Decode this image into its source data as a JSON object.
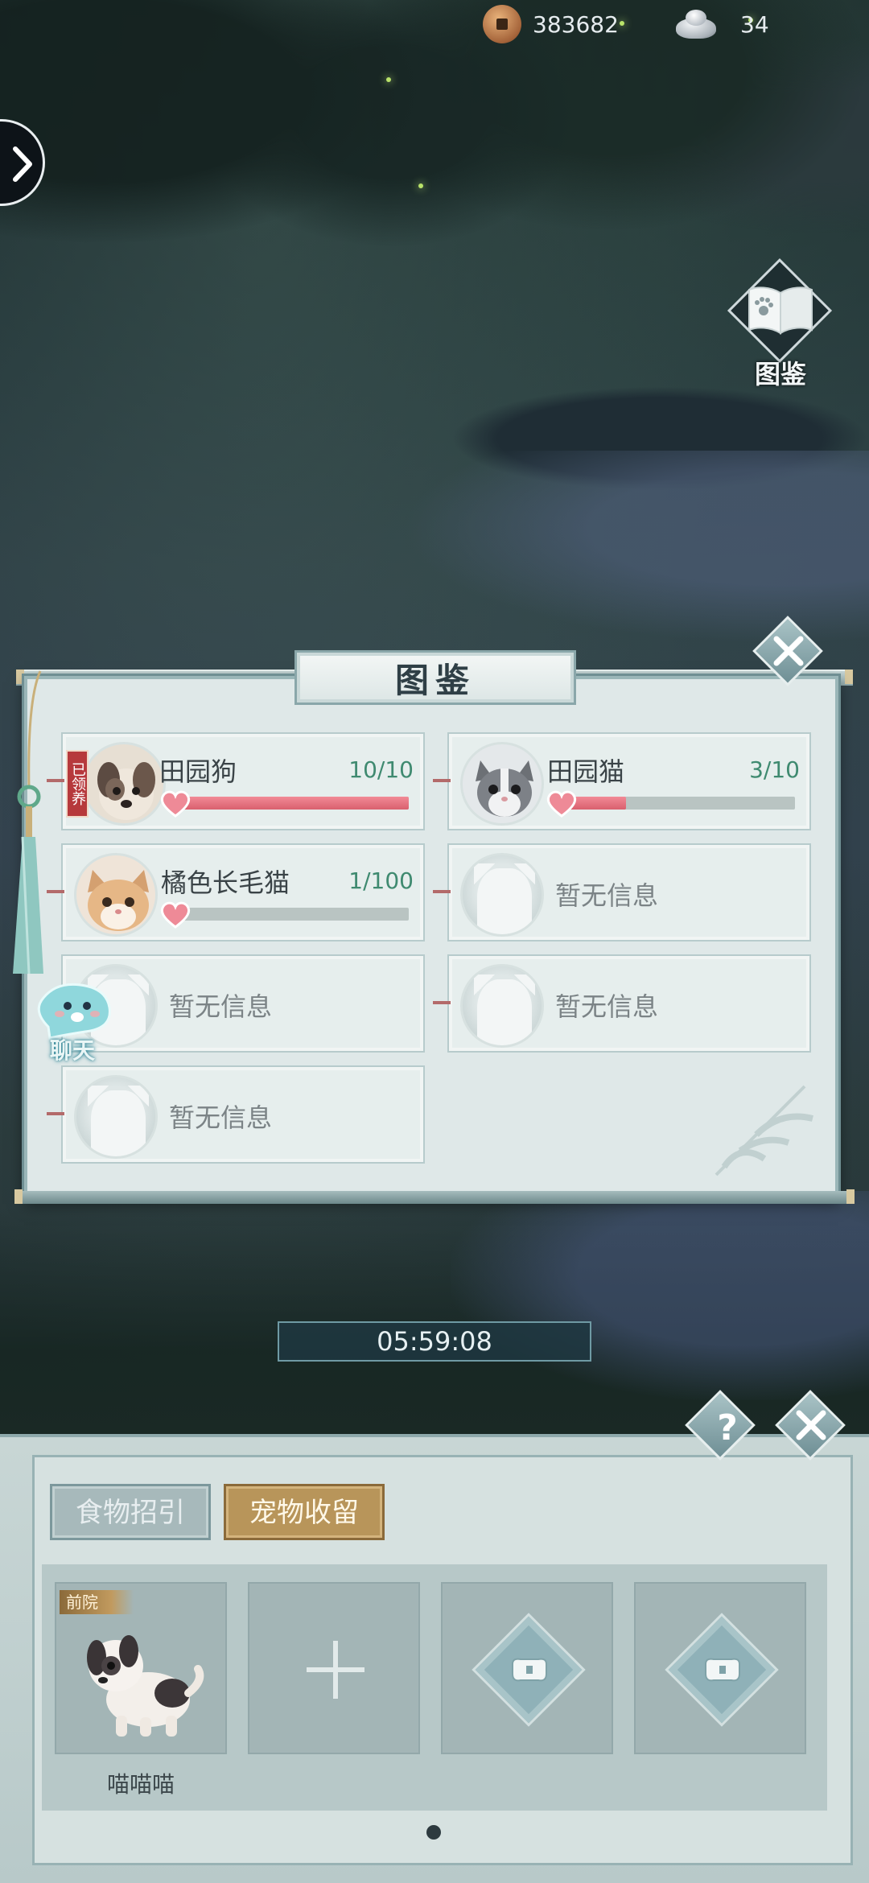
{
  "currency": {
    "coins": "383682",
    "silver": "34"
  },
  "book_button": {
    "label": "图鉴"
  },
  "encyclopedia": {
    "title": "图鉴",
    "pets": [
      {
        "name": "田园狗",
        "count": "10/10",
        "progress": 1.0,
        "adopted": true,
        "adopted_label": "已领养",
        "avatar": "dog"
      },
      {
        "name": "田园猫",
        "count": "3/10",
        "progress": 0.3,
        "adopted": false,
        "avatar": "gray-cat"
      },
      {
        "name": "橘色长毛猫",
        "count": "1/100",
        "progress": 0.01,
        "adopted": false,
        "avatar": "orange-cat"
      },
      {
        "name": "暂无信息",
        "empty": true
      },
      {
        "name": "暂无信息",
        "empty": true
      },
      {
        "name": "暂无信息",
        "empty": true
      },
      {
        "name": "暂无信息",
        "empty": true
      }
    ]
  },
  "chat": {
    "label": "聊天"
  },
  "timer": "05:59:08",
  "bottom": {
    "tabs": [
      {
        "label": "食物招引",
        "active": false
      },
      {
        "label": "宠物收留",
        "active": true
      }
    ],
    "slots": [
      {
        "type": "pet",
        "tag": "前院",
        "name": "喵喵喵"
      },
      {
        "type": "add"
      },
      {
        "type": "locked"
      },
      {
        "type": "locked"
      }
    ],
    "help": "?"
  },
  "colors": {
    "accent_gold": "#b8955a",
    "heart_pink": "#e56f7d",
    "count_green": "#3f8a70"
  }
}
